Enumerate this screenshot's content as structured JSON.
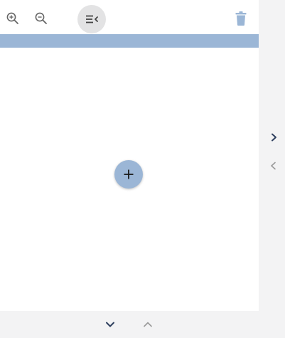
{
  "toolbar": {
    "zoom_in_icon": "zoom-in-icon",
    "zoom_out_icon": "zoom-out-icon",
    "collapse_icon": "collapse-list-icon",
    "delete_icon": "trash-icon"
  },
  "canvas": {
    "add_icon": "plus-icon"
  },
  "side_nav": {
    "next_icon": "chevron-right-icon",
    "prev_icon": "chevron-left-icon"
  },
  "bottom_nav": {
    "down_icon": "chevron-down-icon",
    "up_icon": "chevron-up-icon"
  },
  "colors": {
    "accent": "#9bb6d6",
    "icon_gray": "#666666",
    "dark_navy": "#2e3f5e",
    "light_gray": "#9a9a9a",
    "background": "#f3f3f4",
    "panel": "#ffffff"
  }
}
